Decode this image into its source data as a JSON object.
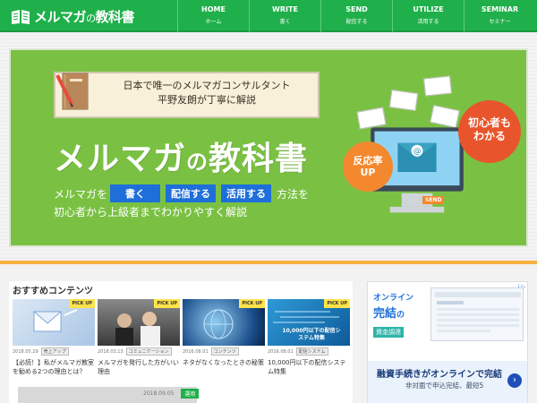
{
  "header": {
    "logo_text": "メルマガ",
    "logo_small": "の",
    "logo_text2": "教科書",
    "nav": [
      {
        "en": "HOME",
        "jp": "ホーム"
      },
      {
        "en": "WRITE",
        "jp": "書く"
      },
      {
        "en": "SEND",
        "jp": "配信する"
      },
      {
        "en": "UTILIZE",
        "jp": "活用する"
      },
      {
        "en": "SEMINAR",
        "jp": "セミナー"
      }
    ]
  },
  "hero": {
    "banner_line1": "日本で唯一のメルマガコンサルタント",
    "banner_line2": "平野友朗が丁寧に解説",
    "title_main": "メルマガ",
    "title_no": "の",
    "title_tail": "教科書",
    "line1_prefix": "メルマガを",
    "tag1": "書く",
    "tag2": "配信する",
    "tag3": "活用する",
    "line1_suffix": "方法を",
    "line2": "初心者から上級者までわかりやすく解説",
    "bubble_orange_1": "反応率",
    "bubble_orange_2": "UP",
    "bubble_red_1": "初心者も",
    "bubble_red_2": "わかる",
    "send_label": "SEND"
  },
  "content": {
    "section_title": "おすすめコンテンツ",
    "cards": [
      {
        "pickup": "PICK UP",
        "date": "2018.05.29",
        "category": "売上アップ",
        "title": "【必読！】私がメルマガ教室を勧める2つの理由とは？"
      },
      {
        "pickup": "PICK UP",
        "date": "2018.03.13",
        "category": "コミュニケーション",
        "title": "メルマガを発行した方がいい理由"
      },
      {
        "pickup": "PICK UP",
        "date": "2016.08.01",
        "category": "コンテンツ",
        "title": "ネタがなくなったときの秘策"
      },
      {
        "pickup": "PICK UP",
        "date": "2016.08.01",
        "category": "配信システム",
        "title": "10,000円以下の配信システム特集",
        "thumb_text": "10,000円以下の配信システム特集"
      }
    ],
    "row2_date": "2018.09.05",
    "row2_category": "運用"
  },
  "ad": {
    "badge": "i ▷",
    "l1": "オンライン",
    "l2": "完結",
    "l2_small": "の",
    "l3": "資金調達",
    "b1": "融資手続きがオンラインで完結",
    "b2": "非対面で申込完結、最短5",
    "arrow": "›"
  }
}
